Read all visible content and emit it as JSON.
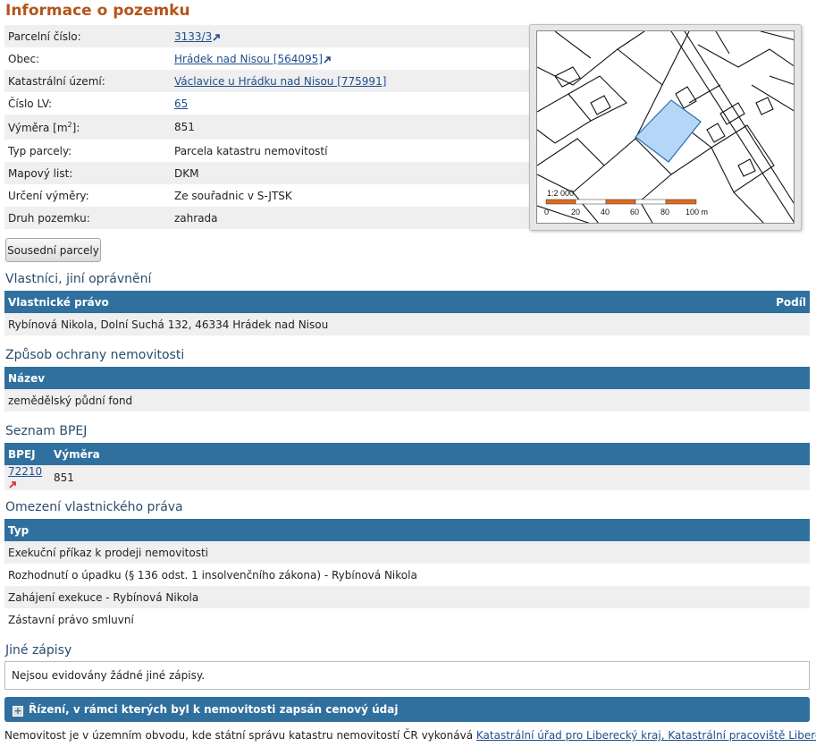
{
  "page_title": "Informace o pozemku",
  "info": {
    "rows": [
      {
        "label": "Parcelní číslo:",
        "value": "3133/3",
        "link": true,
        "ext": true
      },
      {
        "label": "Obec:",
        "value": "Hrádek nad Nisou [564095]",
        "link": true,
        "ext": true
      },
      {
        "label": "Katastrální území:",
        "value": "Václavice u Hrádku nad Nisou [775991]",
        "link": true,
        "ext": false
      },
      {
        "label": "Číslo LV:",
        "value": "65",
        "link": true,
        "ext": false
      },
      {
        "label_main": "Výměra [m",
        "label_sup": "2",
        "label_end": "]:",
        "value": "851"
      },
      {
        "label": "Typ parcely:",
        "value": "Parcela katastru nemovitostí"
      },
      {
        "label": "Mapový list:",
        "value": "DKM"
      },
      {
        "label": "Určení výměry:",
        "value": "Ze souřadnic v S-JTSK"
      },
      {
        "label": "Druh pozemku:",
        "value": "zahrada"
      }
    ]
  },
  "map": {
    "scale_label": "1:2 000",
    "ticks": [
      "0",
      "20",
      "40",
      "60",
      "80",
      "100 m"
    ],
    "parcel_fill": "#b6d6f7",
    "scale_color": "#e06a1e"
  },
  "neighbors_button": "Sousední parcely",
  "owners": {
    "title": "Vlastníci, jiní oprávnění",
    "col_right": "Vlastnické právo",
    "col_share": "Podíl",
    "rows": [
      "Rybínová Nikola, Dolní Suchá 132, 46334 Hrádek nad Nisou"
    ]
  },
  "protection": {
    "title": "Způsob ochrany nemovitosti",
    "col_name": "Název",
    "rows": [
      "zemědělský půdní fond"
    ]
  },
  "bpej": {
    "title": "Seznam BPEJ",
    "col_bpej": "BPEJ",
    "col_area": "Výměra",
    "rows": [
      {
        "code": "72210",
        "area": "851"
      }
    ]
  },
  "restrictions": {
    "title": "Omezení vlastnického práva",
    "col_type": "Typ",
    "rows": [
      "Exekuční příkaz k prodeji nemovitosti",
      "Rozhodnutí o úpadku (§ 136 odst. 1 insolvenčního zákona) - Rybínová Nikola",
      "Zahájení exekuce - Rybínová Nikola",
      "Zástavní právo smluvní"
    ]
  },
  "other": {
    "title": "Jiné zápisy",
    "text": "Nejsou evidovány žádné jiné zápisy."
  },
  "proceedings": {
    "label": "Řízení, v rámci kterých byl k nemovitosti zapsán cenový údaj"
  },
  "footer": {
    "text": "Nemovitost je v územním obvodu, kde státní správu katastru nemovitostí ČR vykonává ",
    "link": "Katastrální úřad pro Liberecký kraj, Katastrální pracoviště Liberec"
  },
  "colors": {
    "title": "#b5541c",
    "header_bg": "#30709e",
    "section_title": "#2a4d6e",
    "row_alt": "#efefef"
  }
}
